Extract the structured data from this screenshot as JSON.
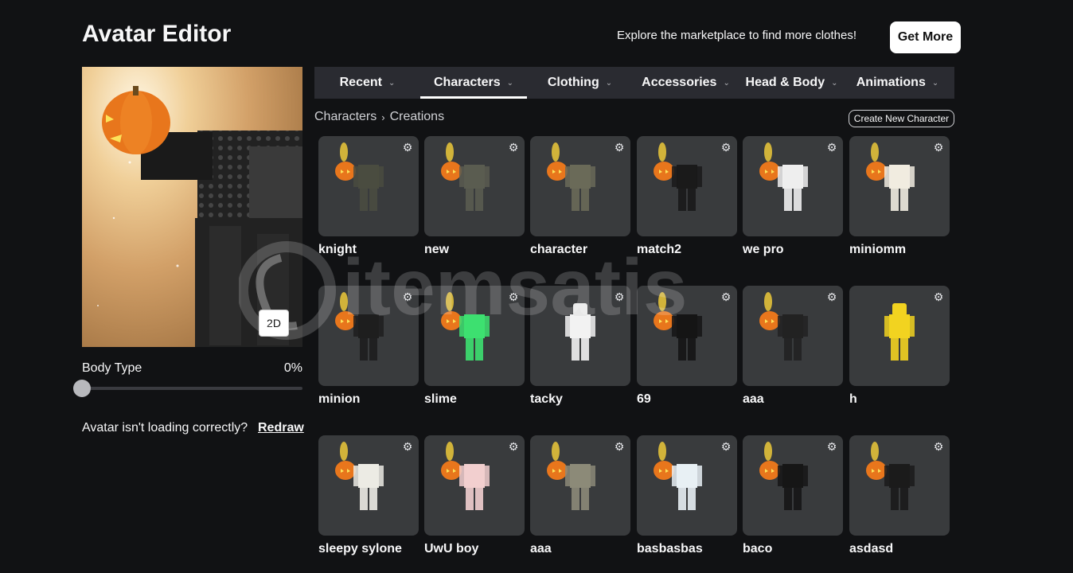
{
  "header": {
    "title": "Avatar Editor",
    "promo_text": "Explore the marketplace to find more clothes!",
    "get_more_label": "Get More"
  },
  "preview": {
    "toggle_2d_label": "2D",
    "body_type_label": "Body Type",
    "body_type_value": "0%",
    "body_type_level": 0,
    "loading_text": "Avatar isn't loading correctly?",
    "redraw_label": "Redraw"
  },
  "tabs": [
    {
      "label": "Recent"
    },
    {
      "label": "Characters"
    },
    {
      "label": "Clothing"
    },
    {
      "label": "Accessories"
    },
    {
      "label": "Head & Body"
    },
    {
      "label": "Animations"
    }
  ],
  "active_tab": "Characters",
  "breadcrumb": {
    "parent": "Characters",
    "separator": "›",
    "current": "Creations"
  },
  "create_button_label": "Create New Character",
  "characters": [
    {
      "name": "knight",
      "color": "#4a4c40"
    },
    {
      "name": "new",
      "color": "#5a5c50"
    },
    {
      "name": "character",
      "color": "#6a6a58"
    },
    {
      "name": "match2",
      "color": "#1a1a1a"
    },
    {
      "name": "we pro",
      "color": "#eeeeee"
    },
    {
      "name": "miniomm",
      "color": "#f1ece0"
    },
    {
      "name": "minion",
      "color": "#1e1e1e"
    },
    {
      "name": "slime",
      "color": "#3de070"
    },
    {
      "name": "tacky",
      "color": "#f2f2f2"
    },
    {
      "name": "69",
      "color": "#151515"
    },
    {
      "name": "aaa",
      "color": "#222222"
    },
    {
      "name": "h",
      "color": "#f2d320"
    },
    {
      "name": "sleepy sylone",
      "color": "#ecebe4"
    },
    {
      "name": "UwU boy",
      "color": "#f2cfcf"
    },
    {
      "name": "aaa",
      "color": "#8c8a78"
    },
    {
      "name": "basbasbas",
      "color": "#e8f0f4"
    },
    {
      "name": "baco",
      "color": "#161616"
    },
    {
      "name": "asdasd",
      "color": "#1b1b1b"
    }
  ],
  "gear_icon": "gear-icon",
  "watermark_text": "itemsatis"
}
